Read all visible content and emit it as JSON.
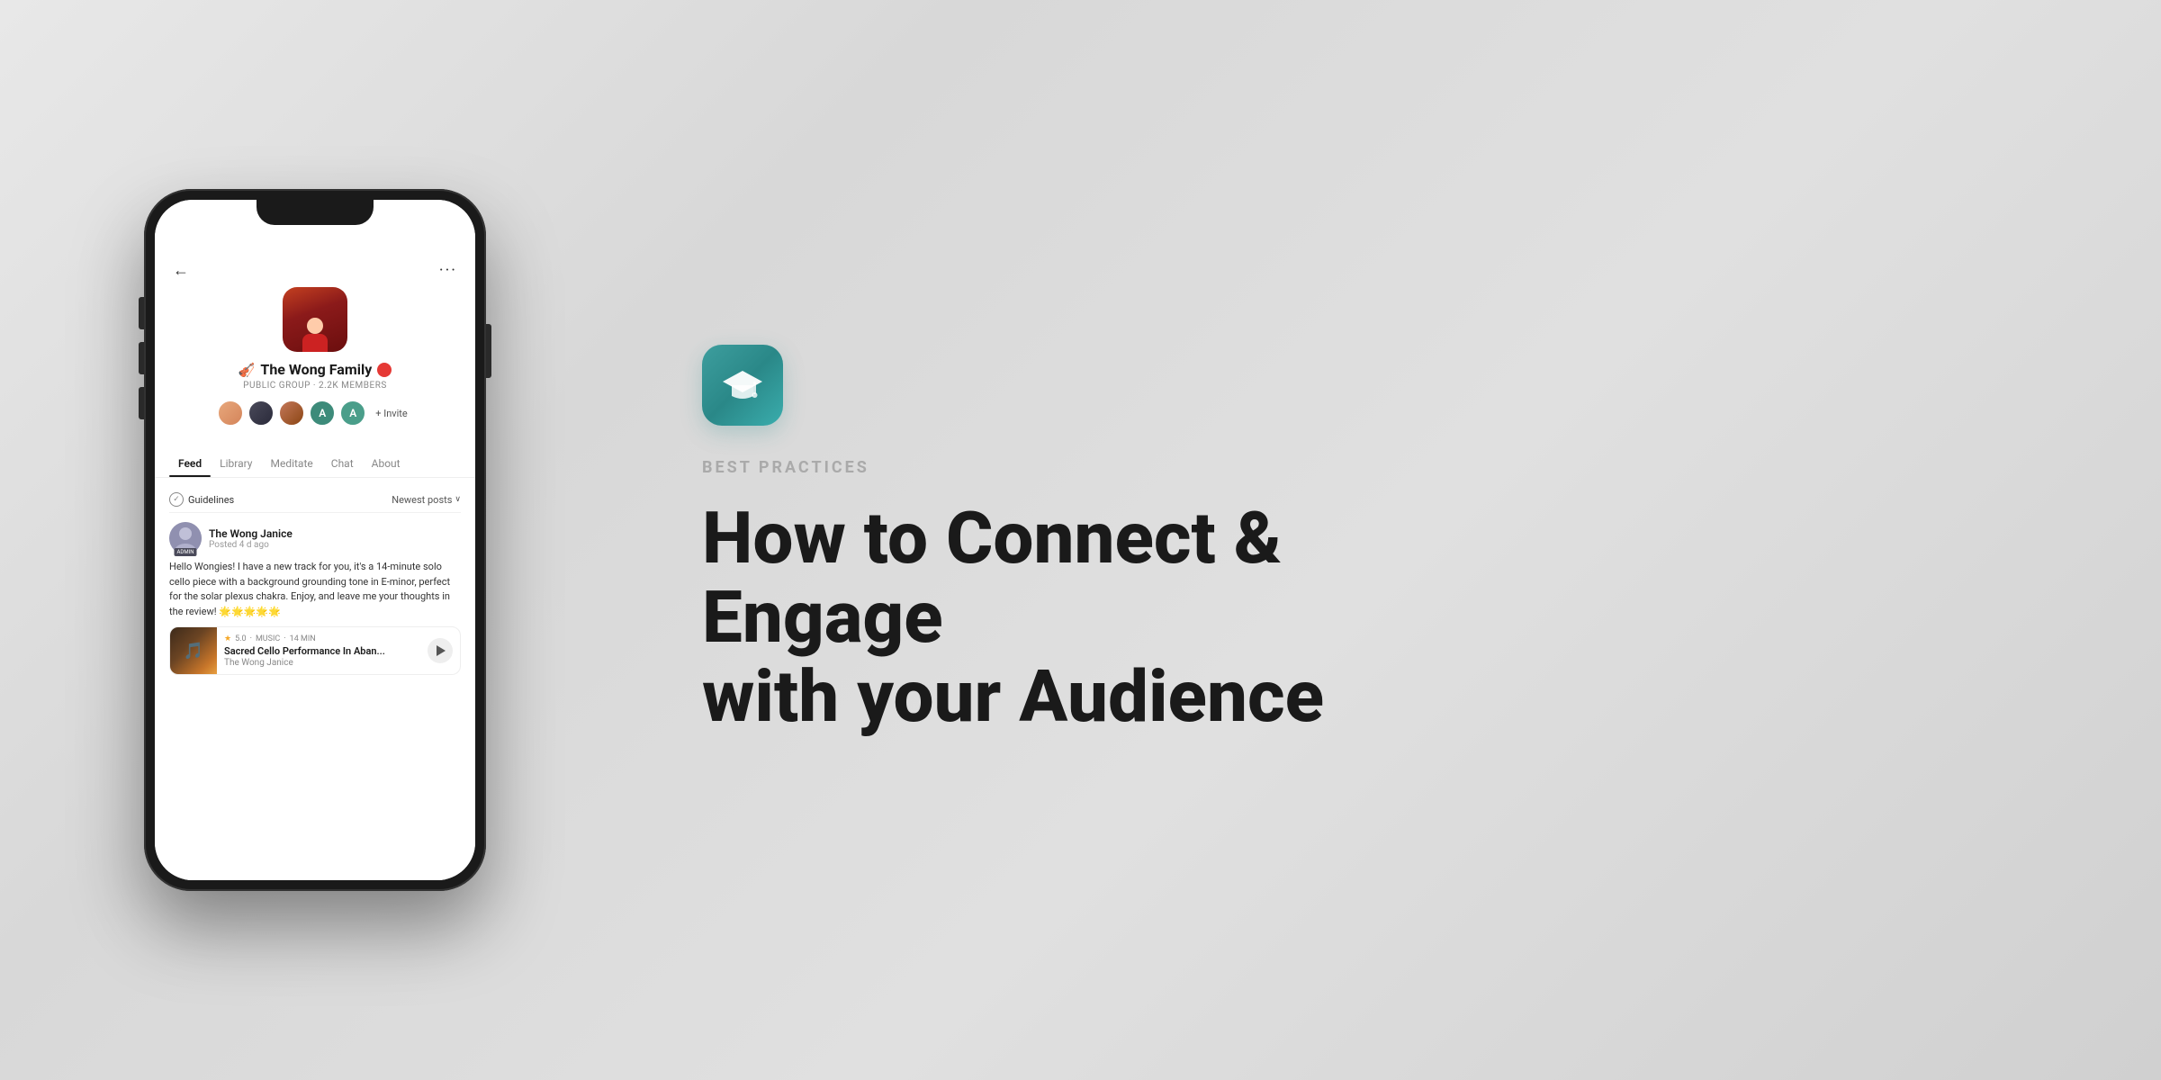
{
  "page": {
    "background": "linear-gradient(135deg, #e8e8e8 0%, #d8d8d8 30%, #e0e0e0 60%, #d0d0d0 100%)"
  },
  "phone": {
    "nav": {
      "back_label": "←",
      "more_label": "···"
    },
    "group": {
      "name_prefix": "🎻",
      "name": "The Wong Family",
      "meta": "PUBLIC GROUP · 2.2K MEMBERS",
      "member_initials": [
        "A",
        "A"
      ],
      "invite_label": "+ Invite"
    },
    "tabs": [
      {
        "label": "Feed",
        "active": true
      },
      {
        "label": "Library",
        "active": false
      },
      {
        "label": "Meditate",
        "active": false
      },
      {
        "label": "Chat",
        "active": false
      },
      {
        "label": "About",
        "active": false
      }
    ],
    "feed": {
      "guidelines_label": "Guidelines",
      "newest_posts_label": "Newest posts",
      "post": {
        "author": "The Wong Janice",
        "time": "Posted 4 d ago",
        "admin_badge": "ADMIN",
        "text": "Hello Wongies! I have a new track for you, it's a 14-minute solo cello piece with a background grounding tone in E-minor, perfect for the solar plexus chakra. Enjoy, and leave me your thoughts in the review! 🌟🌟🌟🌟🌟",
        "music_card": {
          "rating": "5.0",
          "category": "MUSIC",
          "duration": "14 MIN",
          "title": "Sacred Cello Performance In Aban...",
          "artist": "The Wong Janice"
        }
      }
    }
  },
  "right": {
    "badge_icon_alt": "graduation-cap",
    "category_label": "BEST PRACTICES",
    "heading_line1": "How to Connect & Engage",
    "heading_line2": "with your Audience"
  }
}
